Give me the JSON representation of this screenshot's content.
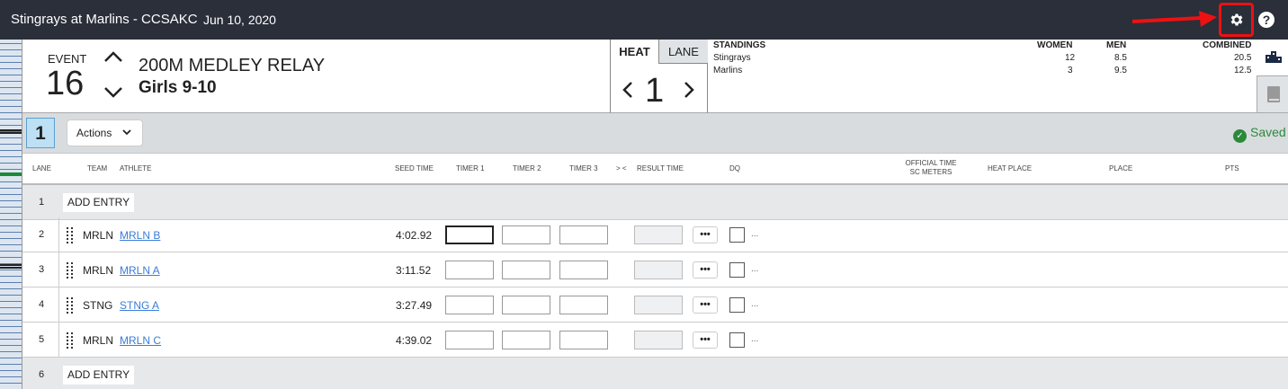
{
  "meet": {
    "title": "Stingrays at Marlins - CCSAKC",
    "date": "Jun 10, 2020"
  },
  "event": {
    "label": "EVENT",
    "number": "16",
    "name": "200M MEDLEY RELAY",
    "group": "Girls 9-10"
  },
  "heat_panel": {
    "tab_heat": "HEAT",
    "tab_lane": "LANE",
    "heat_number": "1"
  },
  "standings": {
    "headers": [
      "STANDINGS",
      "WOMEN",
      "MEN",
      "COMBINED"
    ],
    "rows": [
      {
        "team": "Stingrays",
        "women": "12",
        "men": "8.5",
        "combined": "20.5"
      },
      {
        "team": "Marlins",
        "women": "3",
        "men": "9.5",
        "combined": "12.5"
      }
    ]
  },
  "toolbar": {
    "heat": "1",
    "actions_label": "Actions",
    "status": "Saved"
  },
  "columns": {
    "lane": "LANE",
    "team": "TEAM",
    "athlete": "ATHLETE",
    "seed": "SEED TIME",
    "timer1": "TIMER 1",
    "timer2": "TIMER 2",
    "timer3": "TIMER 3",
    "swap": "> <",
    "result": "RESULT TIME",
    "dq": "DQ",
    "official": "OFFICIAL TIME",
    "official_sub": "SC METERS",
    "heat_place": "HEAT PLACE",
    "place": "PLACE",
    "pts": "PTS"
  },
  "rows": [
    {
      "lane": "1",
      "type": "add",
      "label": "ADD ENTRY"
    },
    {
      "lane": "2",
      "type": "entry",
      "team": "MRLN",
      "athlete": "MRLN B",
      "seed": "4:02.92",
      "more": "•••",
      "dq_more": "..."
    },
    {
      "lane": "3",
      "type": "entry",
      "team": "MRLN",
      "athlete": "MRLN A",
      "seed": "3:11.52",
      "more": "•••",
      "dq_more": "..."
    },
    {
      "lane": "4",
      "type": "entry",
      "team": "STNG",
      "athlete": "STNG A",
      "seed": "3:27.49",
      "more": "•••",
      "dq_more": "..."
    },
    {
      "lane": "5",
      "type": "entry",
      "team": "MRLN",
      "athlete": "MRLN C",
      "seed": "4:39.02",
      "more": "•••",
      "dq_more": "..."
    },
    {
      "lane": "6",
      "type": "add",
      "label": "ADD ENTRY"
    }
  ],
  "icons": {
    "settings": "gear-icon",
    "help": "help-icon",
    "annotation": "red-arrow-icon",
    "heat_sheet": "podium-icon",
    "book": "book-icon"
  },
  "colors": {
    "topbar": "#2a2f3a",
    "highlight": "#e11111",
    "link": "#3b7dd8",
    "saved": "#2a8a3a"
  }
}
